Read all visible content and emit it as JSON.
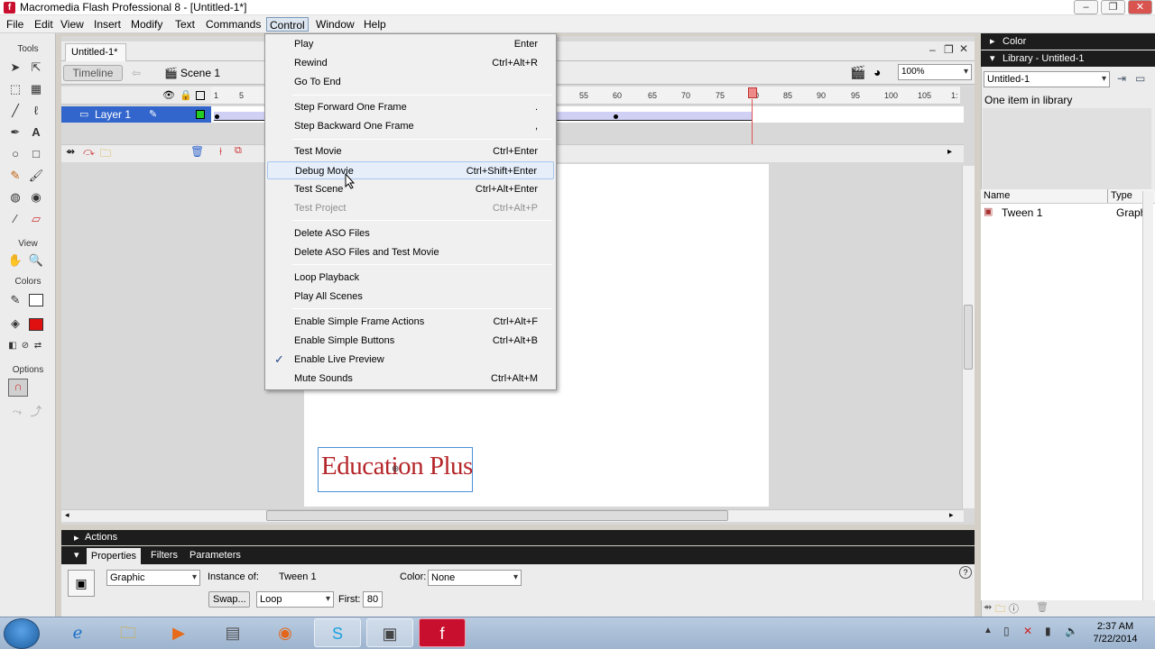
{
  "window": {
    "title": "Macromedia Flash Professional 8 - [Untitled-1*]"
  },
  "menubar": [
    "File",
    "Edit",
    "View",
    "Insert",
    "Modify",
    "Text",
    "Commands",
    "Control",
    "Window",
    "Help"
  ],
  "tools": {
    "section_tools": "Tools",
    "section_view": "View",
    "section_colors": "Colors",
    "section_options": "Options"
  },
  "document": {
    "tab": "Untitled-1*",
    "timeline_btn": "Timeline",
    "scene": "Scene 1",
    "zoom": "100%",
    "layer": "Layer 1"
  },
  "ruler": [
    "1",
    "5",
    "55",
    "60",
    "65",
    "70",
    "75",
    "80",
    "85",
    "90",
    "95",
    "100",
    "105",
    "1:"
  ],
  "stage": {
    "text": "Education Plus"
  },
  "control_menu": {
    "items": [
      {
        "label": "Play",
        "shortcut": "Enter"
      },
      {
        "label": "Rewind",
        "shortcut": "Ctrl+Alt+R"
      },
      {
        "label": "Go To End",
        "shortcut": ""
      },
      {
        "label": "Step Forward One Frame",
        "shortcut": "."
      },
      {
        "label": "Step Backward One Frame",
        "shortcut": ","
      },
      {
        "label": "Test Movie",
        "shortcut": "Ctrl+Enter"
      },
      {
        "label": "Debug Movie",
        "shortcut": "Ctrl+Shift+Enter"
      },
      {
        "label": "Test Scene",
        "shortcut": "Ctrl+Alt+Enter"
      },
      {
        "label": "Test Project",
        "shortcut": "Ctrl+Alt+P"
      },
      {
        "label": "Delete ASO Files",
        "shortcut": ""
      },
      {
        "label": "Delete ASO Files and Test Movie",
        "shortcut": ""
      },
      {
        "label": "Loop Playback",
        "shortcut": ""
      },
      {
        "label": "Play All Scenes",
        "shortcut": ""
      },
      {
        "label": "Enable Simple Frame Actions",
        "shortcut": "Ctrl+Alt+F"
      },
      {
        "label": "Enable Simple Buttons",
        "shortcut": "Ctrl+Alt+B"
      },
      {
        "label": "Enable Live Preview",
        "shortcut": ""
      },
      {
        "label": "Mute Sounds",
        "shortcut": "Ctrl+Alt+M"
      }
    ],
    "highlighted": "Debug Movie",
    "disabled": "Test Project",
    "checked": "Enable Live Preview"
  },
  "actions": {
    "label": "Actions"
  },
  "properties": {
    "tabs": [
      "Properties",
      "Filters",
      "Parameters"
    ],
    "symbol_type": "Graphic",
    "instance_of_label": "Instance of:",
    "instance_of_value": "Tween 1",
    "color_label": "Color:",
    "color_value": "None",
    "swap_btn": "Swap...",
    "loop_value": "Loop",
    "first_label": "First:",
    "first_value": "80"
  },
  "right_panels": {
    "color": "Color",
    "library": "Library - Untitled-1",
    "library_select": "Untitled-1",
    "item_count": "One item in library",
    "col_name": "Name",
    "col_type": "Type",
    "item_name": "Tween 1",
    "item_type": "Graph"
  },
  "taskbar": {
    "time": "2:37 AM",
    "date": "7/22/2014"
  }
}
